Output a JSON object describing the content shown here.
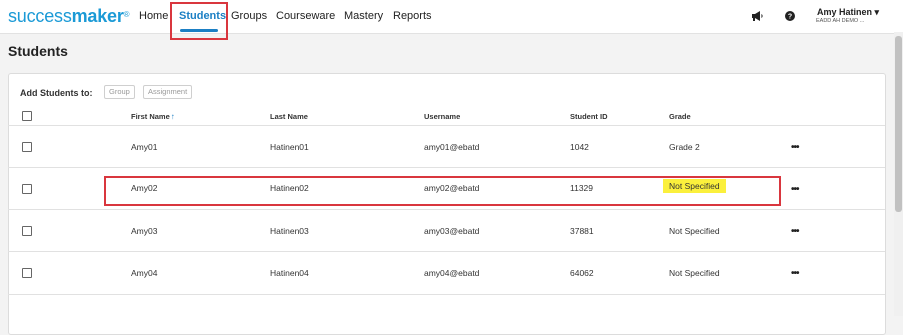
{
  "app": {
    "logo_part1": "success",
    "logo_part2": "maker",
    "logo_mark": "®"
  },
  "nav": {
    "items": [
      {
        "label": "Home"
      },
      {
        "label": "Students"
      },
      {
        "label": "Groups"
      },
      {
        "label": "Courseware"
      },
      {
        "label": "Mastery"
      },
      {
        "label": "Reports"
      }
    ],
    "active": "Students"
  },
  "header_icons": [
    "megaphone-icon",
    "help-icon"
  ],
  "user": {
    "name": "Amy Hatinen",
    "caret": "▾",
    "org": "EADD AH DEMO ..."
  },
  "page": {
    "title": "Students"
  },
  "add_students": {
    "label": "Add Students to:",
    "buttons": [
      "Group",
      "Assignment"
    ]
  },
  "table": {
    "columns": [
      "First Name",
      "Last Name",
      "Username",
      "Student ID",
      "Grade"
    ],
    "sort_indicator": "↑",
    "rows": [
      {
        "first": "Amy01",
        "last": "Hatinen01",
        "username": "amy01@ebatd",
        "id": "1042",
        "grade": "Grade 2",
        "more": "•••"
      },
      {
        "first": "Amy02",
        "last": "Hatinen02",
        "username": "amy02@ebatd",
        "id": "11329",
        "grade": "Not Specified",
        "more": "•••"
      },
      {
        "first": "Amy03",
        "last": "Hatinen03",
        "username": "amy03@ebatd",
        "id": "37881",
        "grade": "Not Specified",
        "more": "•••"
      },
      {
        "first": "Amy04",
        "last": "Hatinen04",
        "username": "amy04@ebatd",
        "id": "64062",
        "grade": "Not Specified",
        "more": "•••"
      }
    ]
  },
  "colors": {
    "accent": "#1b7fc4",
    "logo": "#1b9ad6",
    "annotation_red": "#d9363e",
    "highlight_yellow": "#fbf03c"
  }
}
